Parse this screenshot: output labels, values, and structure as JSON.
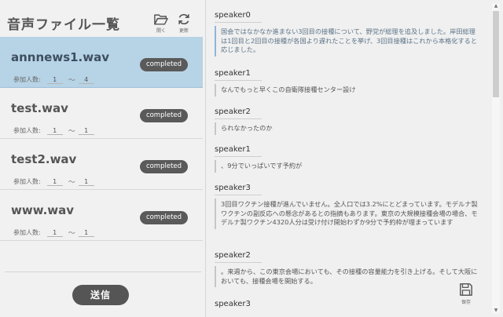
{
  "app": {
    "title": "音声ファイル一覧"
  },
  "toolbar": {
    "open_label": "開く",
    "refresh_label": "更新",
    "save_label": "保存"
  },
  "participants_label": "参加人数:",
  "range_sep": "〜",
  "files": [
    {
      "name": "annnews1.wav",
      "status": "completed",
      "min": "1",
      "max": "4",
      "selected": true
    },
    {
      "name": "test.wav",
      "status": "completed",
      "min": "1",
      "max": "1",
      "selected": false
    },
    {
      "name": "test2.wav",
      "status": "completed",
      "min": "1",
      "max": "1",
      "selected": false
    },
    {
      "name": "www.wav",
      "status": "completed",
      "min": "1",
      "max": "1",
      "selected": false
    }
  ],
  "send_label": "送信",
  "transcript": [
    {
      "speaker": "speaker0",
      "text": "国会ではなかなか進まない3回目の接種について、野党が総理を追及しました。岸田総理は1回目と2回目の接種が各国より遅れたことを挙げ、3回目接種はこれから本格化すると応じました。",
      "active": true
    },
    {
      "speaker": "speaker1",
      "text": "なんでもっと早くこの自衛隊接種センター設け",
      "active": false
    },
    {
      "speaker": "speaker2",
      "text": "られなかったのか",
      "active": false
    },
    {
      "speaker": "speaker1",
      "text": "、9分でいっぱいです予約が",
      "active": false
    },
    {
      "speaker": "speaker3",
      "text": "3回目ワクチン接種が進んでいません。全人口では3.2%にとどまっています。モデルナ製ワクチンの副反応への懸念があるとの指摘もあります。東京の大規模接種会場の場合、モデルナ製ワクチン4320人分は受け付け開始わずか9分で予約枠が埋まっています",
      "active": false
    },
    {
      "speaker": "speaker2",
      "text": "。来週から、この東京会場においても、その接種の容量能力を引き上げる。そして大阪においても、接種会場を開始する。",
      "active": false
    },
    {
      "speaker": "speaker3",
      "text": "",
      "active": false
    }
  ]
}
